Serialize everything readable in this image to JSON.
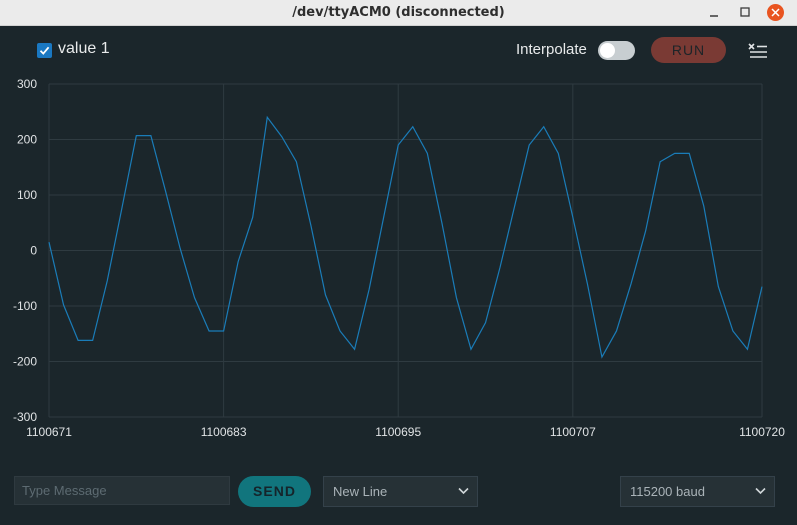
{
  "window": {
    "title": "/dev/ttyACM0 (disconnected)"
  },
  "legend": {
    "series_label": "value 1",
    "checked": true,
    "color": "#1a78c2"
  },
  "toolbar": {
    "interpolate_label": "Interpolate",
    "interpolate_on": false,
    "run_label": "RUN"
  },
  "chart_data": {
    "type": "line",
    "series": [
      {
        "name": "value 1",
        "color": "#1a7cb8",
        "x": [
          1100671,
          1100672,
          1100673,
          1100674,
          1100675,
          1100676,
          1100677,
          1100678,
          1100679,
          1100680,
          1100681,
          1100682,
          1100683,
          1100684,
          1100685,
          1100686,
          1100687,
          1100688,
          1100689,
          1100690,
          1100691,
          1100692,
          1100693,
          1100694,
          1100695,
          1100696,
          1100697,
          1100698,
          1100699,
          1100700,
          1100701,
          1100702,
          1100703,
          1100704,
          1100705,
          1100706,
          1100707,
          1100708,
          1100709,
          1100710,
          1100711,
          1100712,
          1100713,
          1100714,
          1100715,
          1100716,
          1100717,
          1100718,
          1100719,
          1100720
        ],
        "values": [
          15,
          -98,
          -162,
          -162,
          -55,
          75,
          207,
          207,
          108,
          5,
          -85,
          -145,
          -145,
          -20,
          60,
          240,
          205,
          160,
          45,
          -80,
          -145,
          -178,
          -70,
          60,
          190,
          223,
          175,
          50,
          -85,
          -178,
          -130,
          -30,
          80,
          190,
          223,
          175,
          60,
          -60,
          -192,
          -145,
          -60,
          35,
          160,
          175,
          175,
          80,
          -65,
          -145,
          -178,
          -65
        ]
      }
    ],
    "xlim": [
      1100671,
      1100720
    ],
    "ylim": [
      -300,
      300
    ],
    "x_ticks": [
      "1100671",
      "1100683",
      "1100695",
      "1100707",
      "1100720"
    ],
    "y_ticks": [
      "300",
      "200",
      "100",
      "0",
      "-100",
      "-200",
      "-300"
    ],
    "grid": true
  },
  "footer": {
    "message_placeholder": "Type Message",
    "send_label": "SEND",
    "line_ending": "New Line",
    "baud_rate": "115200 baud"
  }
}
